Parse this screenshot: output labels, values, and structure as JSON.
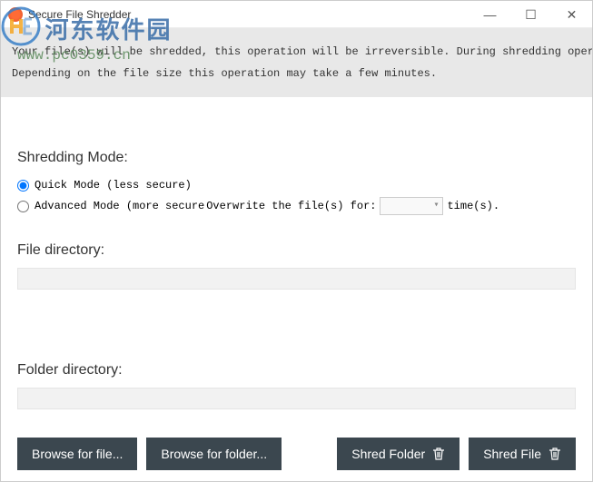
{
  "window": {
    "title": "Secure File Shredder"
  },
  "banner": {
    "line1": "Your file(s) will be shredded, this operation will be irreversible. During shredding operation you can't c",
    "line2": "Depending on the file size this operation may take a few minutes."
  },
  "shredding": {
    "heading": "Shredding Mode:",
    "quick_label": "Quick Mode (less secure)",
    "advanced_prefix": "Advanced Mode (more secure",
    "advanced_mid": "Overwrite the file(s) for:",
    "advanced_suffix": "time(s)."
  },
  "file_dir": {
    "label": "File directory:",
    "value": ""
  },
  "folder_dir": {
    "label": "Folder directory:",
    "value": ""
  },
  "buttons": {
    "browse_file": "Browse for file...",
    "browse_folder": "Browse for folder...",
    "shred_folder": "Shred Folder",
    "shred_file": "Shred File"
  },
  "watermark": {
    "text": "河东软件园",
    "url": "www.pc0359.cn"
  }
}
